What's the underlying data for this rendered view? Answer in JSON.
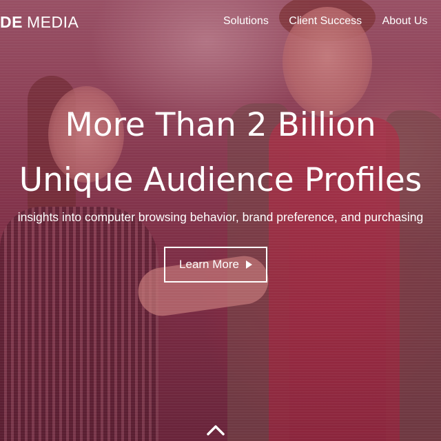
{
  "nav": {
    "logo_bold": "DE",
    "logo_light": "MEDIA",
    "links": [
      {
        "label": "Solutions"
      },
      {
        "label": "Client Success"
      },
      {
        "label": "About Us"
      }
    ]
  },
  "hero": {
    "headline_line1": "More Than 2 Billion",
    "headline_line2": "Unique Audience Profiles",
    "subtext": "insights into computer browsing behavior, brand preference, and purchasing",
    "cta_label": "Learn More",
    "cta_icon": "play-arrow-icon",
    "scroll_icon": "chevron-up-icon"
  },
  "colors": {
    "overlay": "#962846",
    "text": "#ffffff"
  }
}
